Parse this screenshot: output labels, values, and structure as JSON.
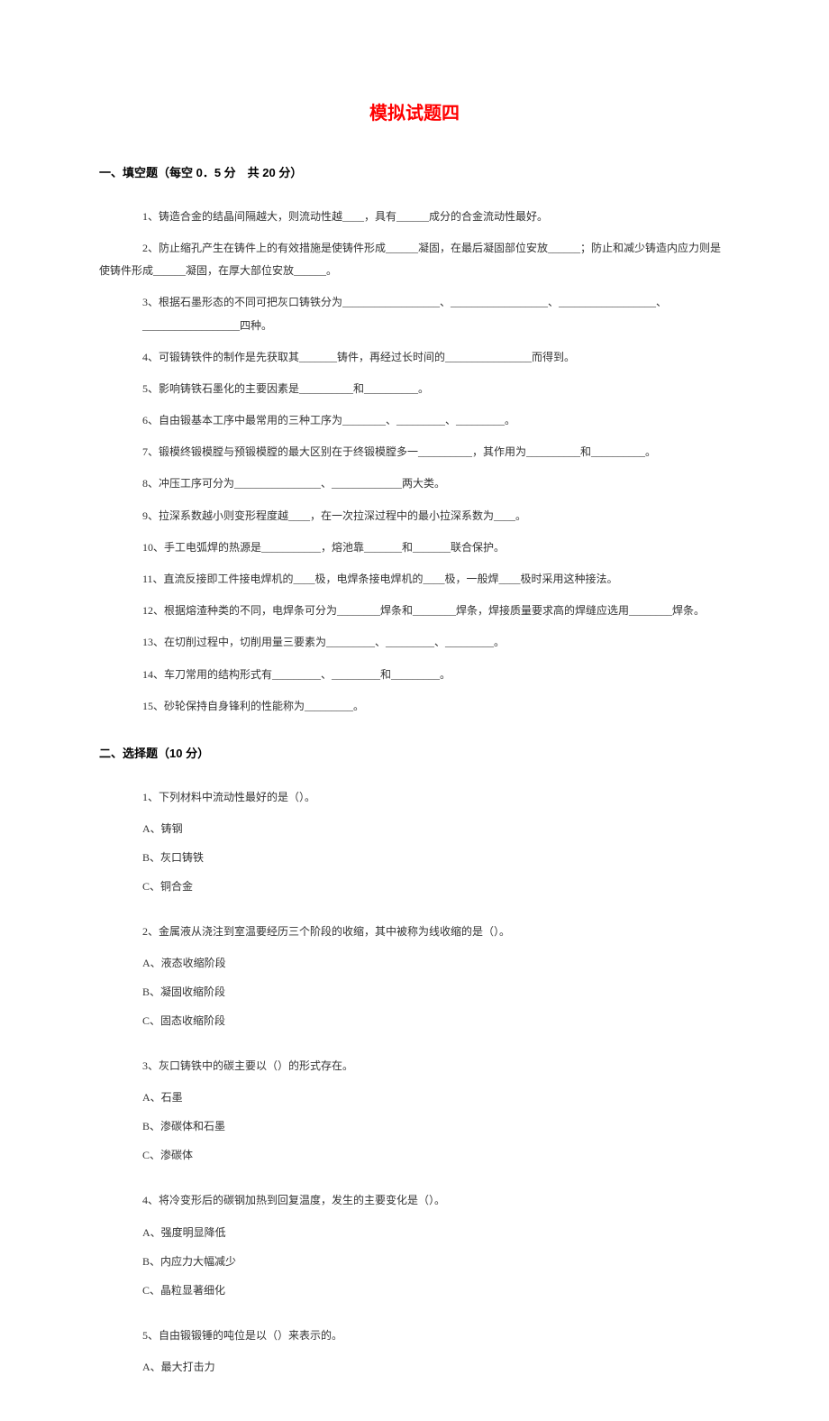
{
  "title": "模拟试题四",
  "section1": {
    "header": "一、填空题（每空 0．5 分　共 20 分）",
    "items": [
      "1、铸造合金的结晶间隔越大，则流动性越____，具有______成分的合金流动性最好。",
      "2、防止缩孔产生在铸件上的有效措施是使铸件形成______凝固，在最后凝固部位安放______；防止和减少铸造内应力则是使铸件形成______凝固，在厚大部位安放______。",
      "3、根据石墨形态的不同可把灰口铸铁分为__________________、__________________、__________________、__________________四种。",
      "4、可锻铸铁件的制作是先获取其_______铸件，再经过长时间的________________而得到。",
      "5、影响铸铁石墨化的主要因素是__________和__________。",
      "6、自由锻基本工序中最常用的三种工序为________、_________、_________。",
      "7、锻模终锻模膛与预锻模膛的最大区别在于终锻模膛多一__________，其作用为__________和__________。",
      "8、冲压工序可分为________________、_____________两大类。",
      "9、拉深系数越小则变形程度越____，在一次拉深过程中的最小拉深系数为____。",
      "10、手工电弧焊的热源是___________，熔池靠_______和_______联合保护。",
      "11、直流反接即工件接电焊机的____极，电焊条接电焊机的____极，一般焊____极时采用这种接法。",
      "12、根据熔渣种类的不同，电焊条可分为________焊条和________焊条，焊接质量要求高的焊缝应选用________焊条。",
      "13、在切削过程中，切削用量三要素为_________、_________、_________。",
      "14、车刀常用的结构形式有_________、_________和_________。",
      "15、砂轮保持自身锋利的性能称为_________。"
    ]
  },
  "section2": {
    "header": "二、选择题（10 分）",
    "questions": [
      {
        "q": "1、下列材料中流动性最好的是（）。",
        "opts": [
          "A、铸钢",
          "B、灰口铸铁",
          "C、铜合金"
        ]
      },
      {
        "q": "2、金属液从浇注到室温要经历三个阶段的收缩，其中被称为线收缩的是（）。",
        "opts": [
          "A、液态收缩阶段",
          "B、凝固收缩阶段",
          "C、固态收缩阶段"
        ]
      },
      {
        "q": "3、灰口铸铁中的碳主要以（）的形式存在。",
        "opts": [
          "A、石墨",
          "B、渗碳体和石墨",
          "C、渗碳体"
        ]
      },
      {
        "q": "4、将冷变形后的碳钢加热到回复温度，发生的主要变化是（）。",
        "opts": [
          "A、强度明显降低",
          "B、内应力大幅减少",
          "C、晶粒显著细化"
        ]
      },
      {
        "q": "5、自由锻锻锤的吨位是以（）来表示的。",
        "opts": [
          "A、最大打击力"
        ]
      }
    ]
  }
}
